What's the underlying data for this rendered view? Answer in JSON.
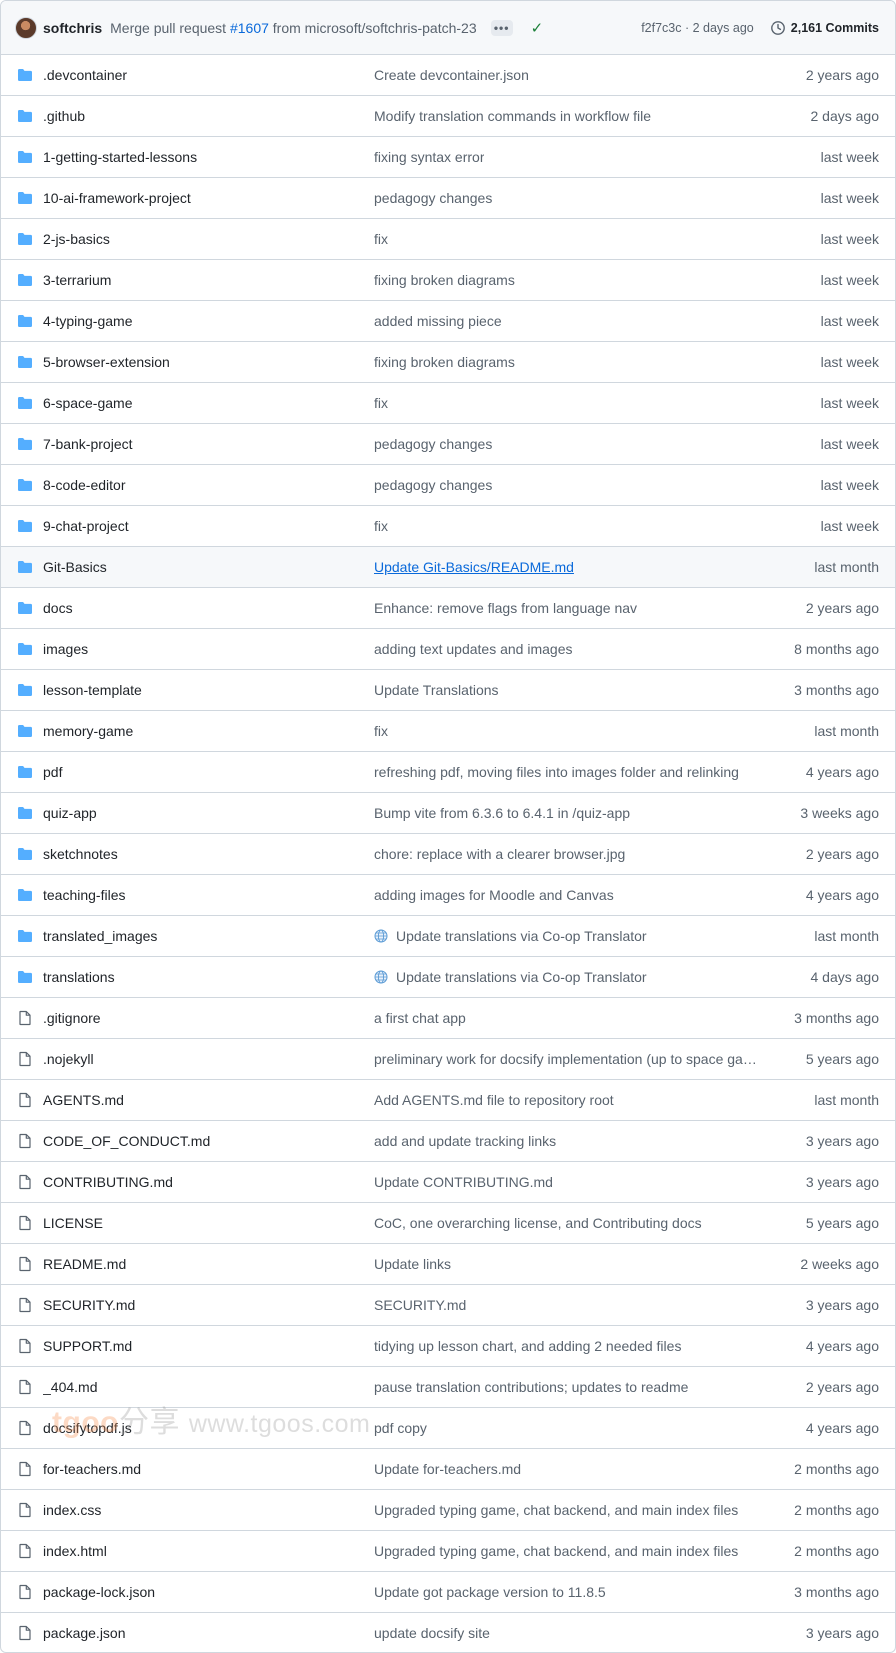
{
  "commit": {
    "author": "softchris",
    "message_prefix": "Merge pull request",
    "pr_number": "#1607",
    "message_suffix": "from microsoft/softchris-patch-23",
    "sha_time": "f2f7c3c · 2 days ago",
    "commits_count": "2,161 Commits",
    "ellipsis": "•••"
  },
  "colors": {
    "folder": "#54aeff",
    "link": "#0969da",
    "muted": "#59636e",
    "success": "#1a7f37"
  },
  "files": [
    {
      "name": ".devcontainer",
      "type": "folder",
      "message": "Create devcontainer.json",
      "date": "2 years ago"
    },
    {
      "name": ".github",
      "type": "folder",
      "message": "Modify translation commands in workflow file",
      "date": "2 days ago"
    },
    {
      "name": "1-getting-started-lessons",
      "type": "folder",
      "message": "fixing syntax error",
      "date": "last week"
    },
    {
      "name": "10-ai-framework-project",
      "type": "folder",
      "message": "pedagogy changes",
      "date": "last week"
    },
    {
      "name": "2-js-basics",
      "type": "folder",
      "message": "fix",
      "date": "last week"
    },
    {
      "name": "3-terrarium",
      "type": "folder",
      "message": "fixing broken diagrams",
      "date": "last week"
    },
    {
      "name": "4-typing-game",
      "type": "folder",
      "message": "added missing piece",
      "date": "last week"
    },
    {
      "name": "5-browser-extension",
      "type": "folder",
      "message": "fixing broken diagrams",
      "date": "last week"
    },
    {
      "name": "6-space-game",
      "type": "folder",
      "message": "fix",
      "date": "last week"
    },
    {
      "name": "7-bank-project",
      "type": "folder",
      "message": "pedagogy changes",
      "date": "last week"
    },
    {
      "name": "8-code-editor",
      "type": "folder",
      "message": "pedagogy changes",
      "date": "last week"
    },
    {
      "name": "9-chat-project",
      "type": "folder",
      "message": "fix",
      "date": "last week"
    },
    {
      "name": "Git-Basics",
      "type": "folder",
      "message": "Update Git-Basics/README.md",
      "date": "last month",
      "highlight": true,
      "link": true
    },
    {
      "name": "docs",
      "type": "folder",
      "message": "Enhance: remove flags from language nav",
      "date": "2 years ago"
    },
    {
      "name": "images",
      "type": "folder",
      "message": "adding text updates and images",
      "date": "8 months ago"
    },
    {
      "name": "lesson-template",
      "type": "folder",
      "message": "Update Translations",
      "date": "3 months ago"
    },
    {
      "name": "memory-game",
      "type": "folder",
      "message": "fix",
      "date": "last month"
    },
    {
      "name": "pdf",
      "type": "folder",
      "message": "refreshing pdf, moving files into images folder and relinking",
      "date": "4 years ago"
    },
    {
      "name": "quiz-app",
      "type": "folder",
      "message": "Bump vite from 6.3.6 to 6.4.1 in /quiz-app",
      "date": "3 weeks ago"
    },
    {
      "name": "sketchnotes",
      "type": "folder",
      "message": "chore: replace with a clearer browser.jpg",
      "date": "2 years ago"
    },
    {
      "name": "teaching-files",
      "type": "folder",
      "message": "adding images for Moodle and Canvas",
      "date": "4 years ago"
    },
    {
      "name": "translated_images",
      "type": "folder",
      "message": "Update translations via Co-op Translator",
      "date": "last month",
      "globe": true
    },
    {
      "name": "translations",
      "type": "folder",
      "message": "Update translations via Co-op Translator",
      "date": "4 days ago",
      "globe": true
    },
    {
      "name": ".gitignore",
      "type": "file",
      "message": "a first chat app",
      "date": "3 months ago"
    },
    {
      "name": ".nojekyll",
      "type": "file",
      "message": "preliminary work for docsify implementation (up to space ga…",
      "date": "5 years ago"
    },
    {
      "name": "AGENTS.md",
      "type": "file",
      "message": "Add AGENTS.md file to repository root",
      "date": "last month"
    },
    {
      "name": "CODE_OF_CONDUCT.md",
      "type": "file",
      "message": "add and update tracking links",
      "date": "3 years ago"
    },
    {
      "name": "CONTRIBUTING.md",
      "type": "file",
      "message": "Update CONTRIBUTING.md",
      "date": "3 years ago"
    },
    {
      "name": "LICENSE",
      "type": "file",
      "message": "CoC, one overarching license, and Contributing docs",
      "date": "5 years ago"
    },
    {
      "name": "README.md",
      "type": "file",
      "message": "Update links",
      "date": "2 weeks ago"
    },
    {
      "name": "SECURITY.md",
      "type": "file",
      "message": "SECURITY.md",
      "date": "3 years ago"
    },
    {
      "name": "SUPPORT.md",
      "type": "file",
      "message": "tidying up lesson chart, and adding 2 needed files",
      "date": "4 years ago"
    },
    {
      "name": "_404.md",
      "type": "file",
      "message": "pause translation contributions; updates to readme",
      "date": "2 years ago"
    },
    {
      "name": "docsifytopdf.js",
      "type": "file",
      "message": "pdf copy",
      "date": "4 years ago"
    },
    {
      "name": "for-teachers.md",
      "type": "file",
      "message": "Update for-teachers.md",
      "date": "2 months ago"
    },
    {
      "name": "index.css",
      "type": "file",
      "message": "Upgraded typing game, chat backend, and main index files",
      "date": "2 months ago"
    },
    {
      "name": "index.html",
      "type": "file",
      "message": "Upgraded typing game, chat backend, and main index files",
      "date": "2 months ago"
    },
    {
      "name": "package-lock.json",
      "type": "file",
      "message": "Update got package version to 11.8.5",
      "date": "3 months ago"
    },
    {
      "name": "package.json",
      "type": "file",
      "message": "update docsify site",
      "date": "3 years ago"
    }
  ],
  "watermark": {
    "brand": "tgoo",
    "cn": "分享",
    "url": "www.tgoos.com"
  }
}
